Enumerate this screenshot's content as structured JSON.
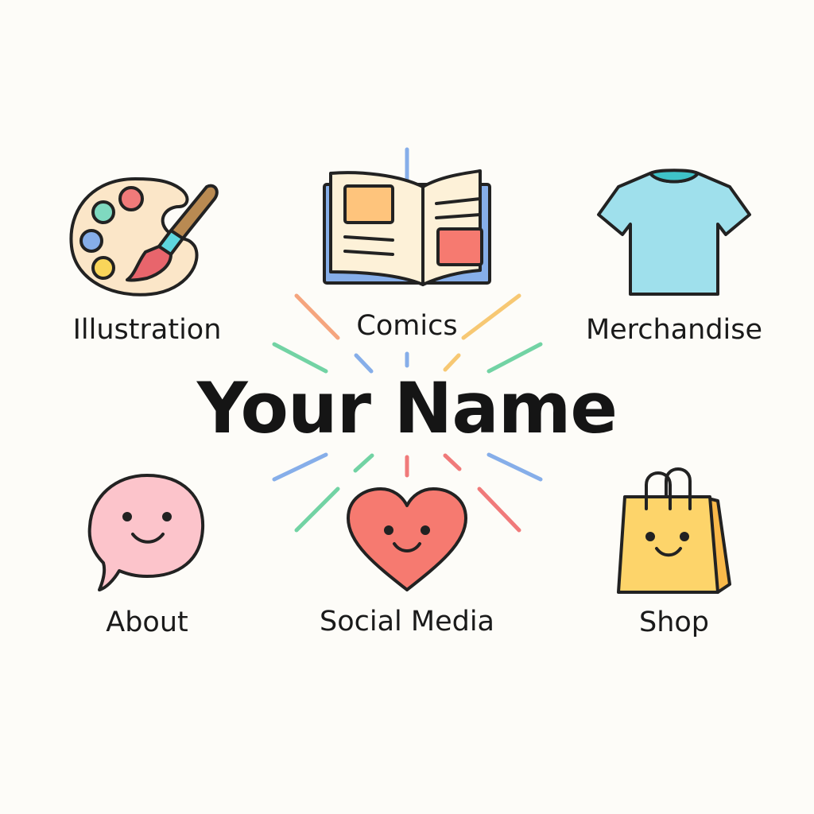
{
  "title": "Your Name",
  "nav": [
    {
      "label": "Illustration",
      "icon": "palette-icon"
    },
    {
      "label": "Comics",
      "icon": "open-book-icon"
    },
    {
      "label": "Merchandise",
      "icon": "t-shirt-icon"
    },
    {
      "label": "About",
      "icon": "speech-bubble-icon"
    },
    {
      "label": "Social Media",
      "icon": "heart-icon"
    },
    {
      "label": "Shop",
      "icon": "shopping-bag-icon"
    }
  ],
  "colors": {
    "background": "#fdfcf8",
    "orange": "#f5a57e",
    "green": "#72d3a4",
    "blue": "#86aee9",
    "red": "#f07a7a",
    "yellow": "#f7c873"
  }
}
